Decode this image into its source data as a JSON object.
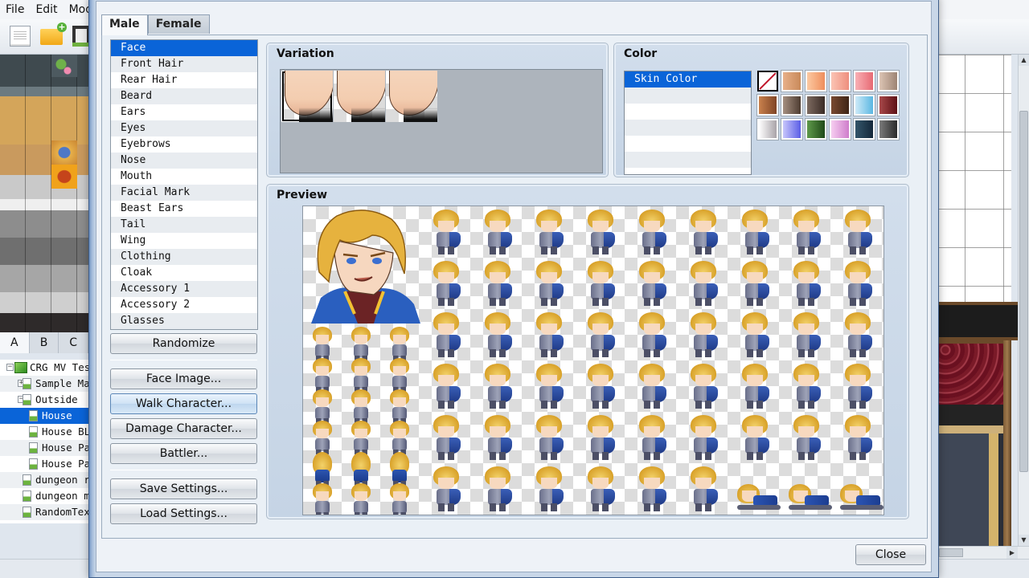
{
  "editor": {
    "menu": [
      "File",
      "Edit",
      "Mode"
    ],
    "toolbar_icons": [
      "new-project-icon",
      "open-project-icon",
      "save-project-icon"
    ],
    "palette_tabs": [
      "A",
      "B",
      "C"
    ],
    "palette_active_tab": "A",
    "map_tree": [
      {
        "label": "CRG MV Test",
        "level": 0,
        "toggle": "-",
        "icon": "project-icon"
      },
      {
        "label": "Sample Map",
        "level": 1,
        "toggle": "+",
        "icon": "map-icon"
      },
      {
        "label": "Outside",
        "level": 1,
        "toggle": "-",
        "icon": "map-icon"
      },
      {
        "label": "House",
        "level": 2,
        "toggle": "",
        "icon": "map-icon",
        "selected": true
      },
      {
        "label": "House BLA",
        "level": 2,
        "toggle": "",
        "icon": "map-icon"
      },
      {
        "label": "House Pa",
        "level": 2,
        "toggle": "",
        "icon": "map-icon"
      },
      {
        "label": "House Pa",
        "level": 2,
        "toggle": "",
        "icon": "map-icon"
      },
      {
        "label": "dungeon ro",
        "level": 1,
        "toggle": "",
        "icon": "map-icon"
      },
      {
        "label": "dungeon ma",
        "level": 1,
        "toggle": "",
        "icon": "map-icon"
      },
      {
        "label": "RandomText",
        "level": 1,
        "toggle": "",
        "icon": "map-icon"
      }
    ]
  },
  "generator": {
    "tabs": [
      "Male",
      "Female"
    ],
    "active_tab": "Male",
    "parts": [
      "Face",
      "Front Hair",
      "Rear Hair",
      "Beard",
      "Ears",
      "Eyes",
      "Eyebrows",
      "Nose",
      "Mouth",
      "Facial Mark",
      "Beast Ears",
      "Tail",
      "Wing",
      "Clothing",
      "Cloak",
      "Accessory 1",
      "Accessory 2",
      "Glasses"
    ],
    "selected_part": "Face",
    "buttons": {
      "randomize": "Randomize",
      "face_image": "Face Image...",
      "walk_character": "Walk Character...",
      "damage_character": "Damage Character...",
      "battler": "Battler...",
      "save_settings": "Save Settings...",
      "load_settings": "Load Settings...",
      "close": "Close"
    },
    "variation": {
      "title": "Variation",
      "count": 3,
      "selected_index": 0
    },
    "color": {
      "title": "Color",
      "layers": [
        "Skin Color"
      ],
      "selected_layer": "Skin Color",
      "swatches": [
        {
          "name": "none",
          "colors": []
        },
        {
          "name": "tan",
          "colors": [
            "#e8b089",
            "#c98a5a"
          ]
        },
        {
          "name": "peach",
          "colors": [
            "#fcc9a2",
            "#ef8e5c"
          ]
        },
        {
          "name": "light-pink",
          "colors": [
            "#fbc4b4",
            "#ee8f7e"
          ]
        },
        {
          "name": "pink",
          "colors": [
            "#f9b0b4",
            "#e76a74"
          ]
        },
        {
          "name": "beige",
          "colors": [
            "#dcc4b3",
            "#9d8474"
          ]
        },
        {
          "name": "brown",
          "colors": [
            "#c9814d",
            "#7f4425"
          ]
        },
        {
          "name": "gray-brown",
          "colors": [
            "#a58f80",
            "#4d3c31"
          ]
        },
        {
          "name": "dark-gray-brown",
          "colors": [
            "#7c6a60",
            "#3b2c26"
          ]
        },
        {
          "name": "dark-brown",
          "colors": [
            "#7a4a31",
            "#3e2416"
          ]
        },
        {
          "name": "light-blue",
          "colors": [
            "#cdeaf8",
            "#5bb7e2"
          ]
        },
        {
          "name": "crimson",
          "colors": [
            "#a8484a",
            "#5c1014"
          ]
        },
        {
          "name": "white",
          "colors": [
            "#ffffff",
            "#a9a3a8"
          ]
        },
        {
          "name": "blue-violet",
          "colors": [
            "#c8c6fb",
            "#5b5ee6"
          ]
        },
        {
          "name": "green",
          "colors": [
            "#5f9a4a",
            "#1f4a18"
          ]
        },
        {
          "name": "orchid",
          "colors": [
            "#f6cdf0",
            "#cf7dcb"
          ]
        },
        {
          "name": "navy",
          "colors": [
            "#34556a",
            "#14283a"
          ]
        },
        {
          "name": "charcoal",
          "colors": [
            "#7a7a7a",
            "#2b2b2b"
          ]
        }
      ]
    },
    "preview": {
      "title": "Preview"
    }
  }
}
